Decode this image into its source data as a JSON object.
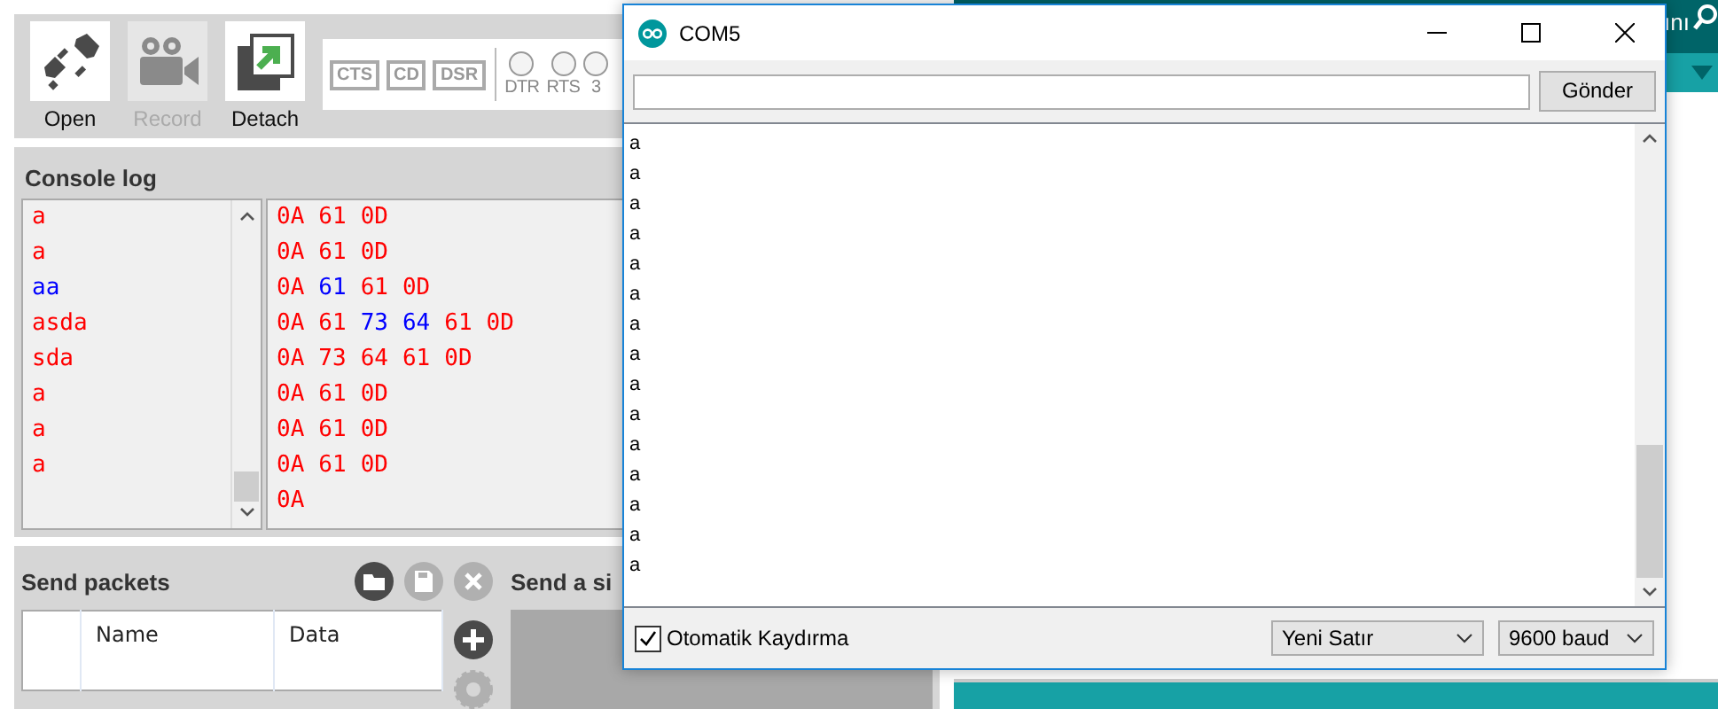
{
  "toolbar": {
    "buttons": [
      {
        "label": "Open",
        "kind": "plug",
        "disabled": false
      },
      {
        "label": "Record",
        "kind": "camera",
        "disabled": true
      },
      {
        "label": "Detach",
        "kind": "detach",
        "disabled": false
      }
    ],
    "signals": [
      {
        "label": "CTS",
        "kind": "badge",
        "on": false
      },
      {
        "label": "CD",
        "kind": "badge",
        "on": false
      },
      {
        "label": "DSR",
        "kind": "badge",
        "on": false
      },
      {
        "label": "DTR",
        "kind": "led",
        "on": false
      },
      {
        "label": "RTS",
        "kind": "led",
        "on": false
      },
      {
        "label": "3",
        "kind": "led",
        "on": false
      }
    ]
  },
  "console_log": {
    "title": "Console log",
    "text_lines": [
      {
        "text": "a",
        "color": "#ff0000"
      },
      {
        "text": "a",
        "color": "#ff0000"
      },
      {
        "text": "aa",
        "color": "#0000ff"
      },
      {
        "text": "asda",
        "color": "#ff0000"
      },
      {
        "text": "sda",
        "color": "#ff0000"
      },
      {
        "text": "a",
        "color": "#ff0000"
      },
      {
        "text": "a",
        "color": "#ff0000"
      },
      {
        "text": "a",
        "color": "#ff0000"
      }
    ],
    "hex_lines": [
      {
        "bytes": [
          {
            "text": "0A",
            "color": "#ff0000"
          },
          {
            "text": "61",
            "color": "#ff0000"
          },
          {
            "text": "0D",
            "color": "#ff0000"
          }
        ]
      },
      {
        "bytes": [
          {
            "text": "0A",
            "color": "#ff0000"
          },
          {
            "text": "61",
            "color": "#ff0000"
          },
          {
            "text": "0D",
            "color": "#ff0000"
          }
        ]
      },
      {
        "bytes": [
          {
            "text": "0A",
            "color": "#ff0000"
          },
          {
            "text": "61",
            "color": "#0000ff"
          },
          {
            "text": "61",
            "color": "#ff0000"
          },
          {
            "text": "0D",
            "color": "#ff0000"
          }
        ]
      },
      {
        "bytes": [
          {
            "text": "0A",
            "color": "#ff0000"
          },
          {
            "text": "61",
            "color": "#ff0000"
          },
          {
            "text": "73",
            "color": "#0000ff"
          },
          {
            "text": "64",
            "color": "#0000ff"
          },
          {
            "text": "61",
            "color": "#ff0000"
          },
          {
            "text": "0D",
            "color": "#ff0000"
          }
        ]
      },
      {
        "bytes": [
          {
            "text": "0A",
            "color": "#ff0000"
          },
          {
            "text": "73",
            "color": "#ff0000"
          },
          {
            "text": "64",
            "color": "#ff0000"
          },
          {
            "text": "61",
            "color": "#ff0000"
          },
          {
            "text": "0D",
            "color": "#ff0000"
          }
        ]
      },
      {
        "bytes": [
          {
            "text": "0A",
            "color": "#ff0000"
          },
          {
            "text": "61",
            "color": "#ff0000"
          },
          {
            "text": "0D",
            "color": "#ff0000"
          }
        ]
      },
      {
        "bytes": [
          {
            "text": "0A",
            "color": "#ff0000"
          },
          {
            "text": "61",
            "color": "#ff0000"
          },
          {
            "text": "0D",
            "color": "#ff0000"
          }
        ]
      },
      {
        "bytes": [
          {
            "text": "0A",
            "color": "#ff0000"
          },
          {
            "text": "61",
            "color": "#ff0000"
          },
          {
            "text": "0D",
            "color": "#ff0000"
          }
        ]
      },
      {
        "bytes": [
          {
            "text": "0A",
            "color": "#ff0000"
          }
        ]
      }
    ]
  },
  "send_packets": {
    "title": "Send packets",
    "columns": [
      "Name",
      "Data"
    ]
  },
  "send_single": {
    "title": "Send a si"
  },
  "background_window": {
    "menu_text": "ını"
  },
  "serial_monitor": {
    "title": "COM5",
    "send_button": "Gönder",
    "output_lines": [
      "a",
      "a",
      "a",
      "a",
      "a",
      "a",
      "a",
      "a",
      "a",
      "a",
      "a",
      "a",
      "a",
      "a",
      "a"
    ],
    "autoscroll": {
      "label": "Otomatik Kaydırma",
      "checked": true
    },
    "line_ending": "Yeni Satır",
    "baud": "9600 baud"
  }
}
